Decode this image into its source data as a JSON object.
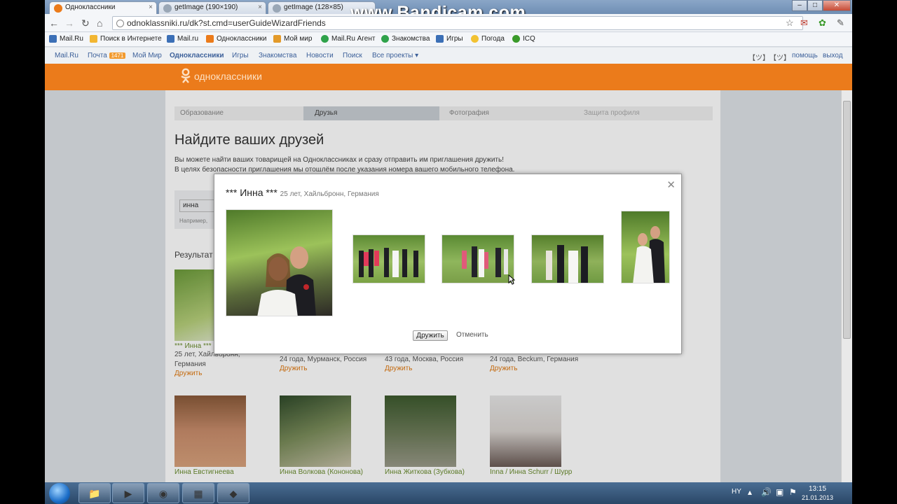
{
  "browser": {
    "tabs": [
      {
        "label": "Одноклассники"
      },
      {
        "label": "getImage (190×190)"
      },
      {
        "label": "getImage (128×85)"
      }
    ],
    "watermark": "www.Bandicam.com",
    "url": "odnoklassniki.ru/dk?st.cmd=userGuideWizardFriends",
    "bookmarks": [
      "Mail.Ru",
      "Поиск в Интернете",
      "Mail.ru",
      "Одноклассники",
      "Мой мир",
      "Mail.Ru Агент",
      "Знакомства",
      "Игры",
      "Погода",
      "ICQ"
    ]
  },
  "portal": {
    "links": [
      "Mail.Ru",
      "Почта",
      "Мой Мир",
      "Одноклассники",
      "Игры",
      "Знакомства",
      "Новости",
      "Поиск",
      "Все проекты ▾"
    ],
    "mail_badge": "1471",
    "right": [
      "помощь",
      "выход"
    ]
  },
  "site": {
    "name": "одноклассники"
  },
  "wizard": {
    "steps": [
      "Образование",
      "Друзья",
      "Фотография",
      "Защита профиля"
    ]
  },
  "page": {
    "title": "Найдите ваших друзей",
    "intro_1": "Вы можете найти ваших товарищей на Одноклассниках и сразу отправить им приглашения дружить!",
    "intro_2": "В целях безопасности приглашения мы отошлём после указания номера вашего мобильного телефона.",
    "search_value": "инна",
    "search_hint": "Например, ",
    "results_label": "Результат"
  },
  "results_row1": [
    {
      "name": "*** Инна ***",
      "meta_1": "25 лет, Хайльбронн,",
      "meta_2": "Германия",
      "action": "Дружить"
    },
    {
      "name": "",
      "meta_1": "24 года, Мурманск, Россия",
      "meta_2": "",
      "action": "Дружить"
    },
    {
      "name": "",
      "meta_1": "43 года, Москва, Россия",
      "meta_2": "",
      "action": "Дружить"
    },
    {
      "name": "",
      "meta_1": "24 года, Beckum, Германия",
      "meta_2": "",
      "action": "Дружить"
    }
  ],
  "results_row2": [
    {
      "name": "Инна Евстигнеева"
    },
    {
      "name": "Инна Волкова (Кононова)"
    },
    {
      "name": "Инна Житкова (Зубкова)"
    },
    {
      "name": "Inna / Инна Schurr / Шурр"
    }
  ],
  "modal": {
    "title": "*** Инна ***",
    "subtitle": "25 лет, Хайльбронн, Германия",
    "friend_button": "Дружить",
    "cancel": "Отменить"
  },
  "taskbar": {
    "lang": "HY",
    "time": "13:15",
    "date": "21.01.2013"
  },
  "colors": {
    "ok_orange": "#eb7b1b",
    "link_green": "#6a8c2f",
    "link_orange": "#e07a12"
  }
}
